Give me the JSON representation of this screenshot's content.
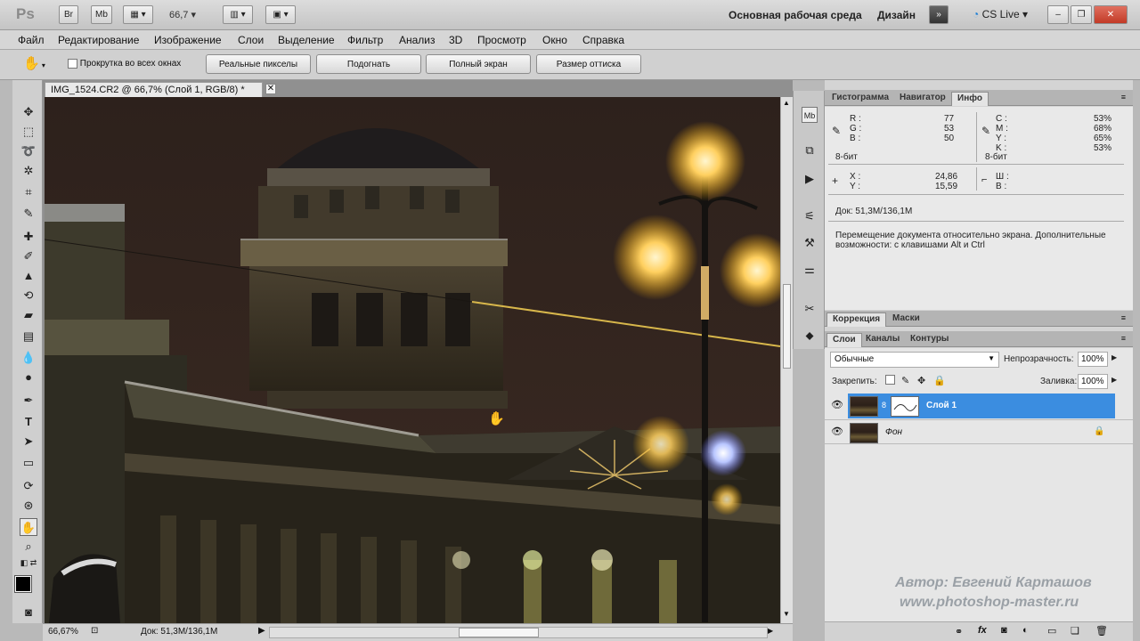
{
  "appbar": {
    "logo": "Ps",
    "br_label": "Br",
    "mb_label": "Mb",
    "zoom": "66,7",
    "workspace_essentials": "Основная рабочая среда",
    "workspace_design": "Дизайн",
    "cs_live": "CS Live"
  },
  "menu": [
    "Файл",
    "Редактирование",
    "Изображение",
    "Слои",
    "Выделение",
    "Фильтр",
    "Анализ",
    "3D",
    "Просмотр",
    "Окно",
    "Справка"
  ],
  "options": {
    "scroll_all_label": "Прокрутка во всех окнах",
    "actual_pixels": "Реальные пикселы",
    "fit_screen": "Подогнать",
    "fill_screen": "Полный экран",
    "print_size": "Размер оттиска"
  },
  "document": {
    "tab_title": "IMG_1524.CR2 @ 66,7% (Слой 1, RGB/8) *"
  },
  "status": {
    "zoom": "66,67%",
    "doc": "Док: 51,3M/136,1M"
  },
  "info_panel": {
    "tabs": [
      "Гистограмма",
      "Навигатор",
      "Инфо"
    ],
    "rgb_labels": [
      "R :",
      "G :",
      "B :"
    ],
    "rgb_values": [
      "77",
      "53",
      "50"
    ],
    "cmyk_labels": [
      "C :",
      "M :",
      "Y :",
      "K :"
    ],
    "cmyk_values": [
      "53%",
      "68%",
      "65%",
      "53%"
    ],
    "bit_left": "8-бит",
    "bit_right": "8-бит",
    "xy_labels": [
      "X :",
      "Y :"
    ],
    "xy_values": [
      "24,86",
      "15,59"
    ],
    "wh_labels": [
      "Ш :",
      "В :"
    ],
    "doc_size": "Док: 51,3M/136,1M",
    "hint": "Перемещение документа относительно экрана. Дополнительные возможности: с клавишами Alt и Ctrl"
  },
  "adjust_panel": {
    "tabs": [
      "Коррекция",
      "Маски"
    ]
  },
  "layers_panel": {
    "tabs": [
      "Слои",
      "Каналы",
      "Контуры"
    ],
    "blend_mode": "Обычные",
    "opacity_label": "Непрозрачность:",
    "opacity": "100%",
    "lock_label": "Закрепить:",
    "fill_label": "Заливка:",
    "fill": "100%",
    "layers": [
      {
        "name": "Слой 1",
        "selected": true
      },
      {
        "name": "Фон",
        "selected": false
      }
    ]
  },
  "watermark": {
    "line1": "Автор: Евгений Карташов",
    "line2": "www.photoshop-master.ru"
  },
  "colors": {
    "selection_blue": "#3b8de0",
    "foreground": "#000000",
    "background": "#ffffff"
  },
  "icons": [
    "hand-icon",
    "move-icon",
    "marquee-icon",
    "lasso-icon",
    "magic-wand-icon",
    "crop-icon",
    "eyedropper-icon",
    "healing-icon",
    "brush-icon",
    "stamp-icon",
    "history-brush-icon",
    "eraser-icon",
    "gradient-icon",
    "blur-icon",
    "dodge-icon",
    "pen-icon",
    "type-icon",
    "path-select-icon",
    "shape-icon",
    "3d-rotate-icon",
    "3d-orbit-icon",
    "zoom-icon",
    "eye-icon",
    "lock-icon",
    "link-icon",
    "fx-icon",
    "mask-icon",
    "new-layer-icon",
    "trash-icon",
    "folder-icon"
  ]
}
